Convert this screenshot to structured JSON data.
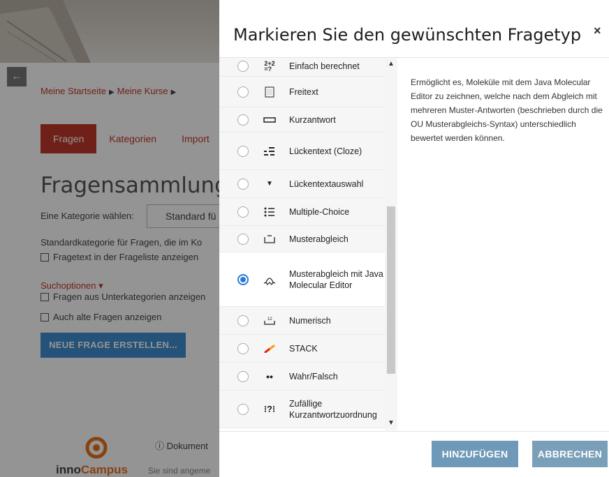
{
  "background_page": {
    "back_icon": "arrow-left-icon",
    "breadcrumb": [
      "Meine Startseite",
      "Meine Kurse"
    ],
    "tabs": [
      "Fragen",
      "Kategorien",
      "Import"
    ],
    "heading": "Fragensammlung",
    "category_label": "Eine Kategorie wählen:",
    "category_value": "Standard fü",
    "category_note": "Standardkategorie für Fragen, die im Ko",
    "show_text_label": "Fragetext in der Frageliste anzeigen",
    "search_options": "Suchoptionen ▾",
    "subcategories_label": "Fragen aus Unterkategorien anzeigen",
    "old_questions_label": "Auch alte Fragen anzeigen",
    "new_question_button": "NEUE FRAGE ERSTELLEN...",
    "documentation": "Dokument",
    "logged_in_text": "Sie sind angeme",
    "brand_prefix": "inno",
    "brand_suffix": "Campus"
  },
  "modal": {
    "title": "Markieren Sie den gewünschten Fragetyp",
    "close_icon": "close-icon",
    "options": [
      {
        "label": "Einfach berechnet",
        "icon": "calculated-icon",
        "glyph": "2+2=?"
      },
      {
        "label": "Freitext",
        "icon": "essay-icon",
        "glyph": "▤"
      },
      {
        "label": "Kurzantwort",
        "icon": "short-answer-icon",
        "glyph": "▭"
      },
      {
        "label": "Lückentext (Cloze)",
        "icon": "cloze-icon",
        "glyph": "⠿"
      },
      {
        "label": "Lückentextauswahl",
        "icon": "dropdown-triangle-icon",
        "glyph": "▼"
      },
      {
        "label": "Multiple-Choice",
        "icon": "list-icon",
        "glyph": "⋮≡"
      },
      {
        "label": "Musterabgleich",
        "icon": "pattern-match-icon",
        "glyph": "⊔"
      },
      {
        "label": "Musterabgleich mit Java Molecular Editor",
        "icon": "molecule-icon",
        "glyph": "Ω"
      },
      {
        "label": "Numerisch",
        "icon": "numerical-icon",
        "glyph": "¹²"
      },
      {
        "label": "STACK",
        "icon": "stack-icon",
        "glyph": "⁄"
      },
      {
        "label": "Wahr/Falsch",
        "icon": "true-false-icon",
        "glyph": "••"
      },
      {
        "label": "Zufällige Kurzantwortzuordnung",
        "icon": "random-match-icon",
        "glyph": "⁝?⁝"
      }
    ],
    "selected_index": 7,
    "description": "Ermöglicht es, Moleküle mit dem Java Molecular Editor zu zeichnen, welche nach dem Abgleich mit mehreren Muster-Antworten (beschrieben durch die OU Musterabgleichs-Syntax) unterschiedlich bewertet werden können.",
    "add_button": "HINZUFÜGEN",
    "cancel_button": "ABBRECHEN"
  },
  "colors": {
    "accent_red": "#c0392b",
    "radio_blue": "#2b7bd3",
    "button_blue": "#6e99b8",
    "brand_orange": "#e8731b"
  }
}
